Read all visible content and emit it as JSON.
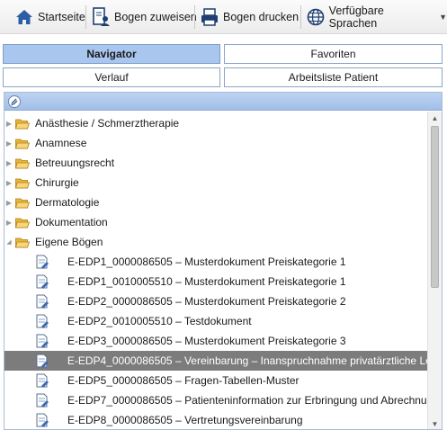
{
  "toolbar": {
    "home": "Startseite",
    "assign": "Bogen zuweisen",
    "print": "Bogen drucken",
    "languages": "Verfügbare Sprachen",
    "icons": {
      "home": "home-icon",
      "assign": "assign-form-icon",
      "print": "printer-icon",
      "languages": "globe-icon"
    }
  },
  "tabs": {
    "navigator": "Navigator",
    "favorites": "Favoriten",
    "history": "Verlauf",
    "worklist": "Arbeitsliste Patient"
  },
  "tree": {
    "folders": [
      "Anästhesie / Schmerztherapie",
      "Anamnese",
      "Betreuungsrecht",
      "Chirurgie",
      "Dermatologie",
      "Dokumentation",
      "Eigene Bögen"
    ],
    "documents": [
      "E-EDP1_0000086505 – Musterdokument Preiskategorie 1",
      "E-EDP1_0010005510 – Musterdokument Preiskategorie 1",
      "E-EDP2_0000086505 – Musterdokument Preiskategorie 2",
      "E-EDP2_0010005510 – Testdokument",
      "E-EDP3_0000086505 – Musterdokument Preiskategorie 3",
      "E-EDP4_0000086505 – Vereinbarung – Inanspruchnahme privatärztliche Le",
      "E-EDP5_0000086505 – Fragen-Tabellen-Muster",
      "E-EDP7_0000086505 – Patienteninformation zur Erbringung und Abrechnu",
      "E-EDP8_0000086505 – Vertretungsvereinbarung"
    ],
    "selected_document": "E-EDP4_0000086505 – Vereinbarung – Inanspruchnahme privatärztliche Le"
  },
  "colors": {
    "accent": "#a9c6ef",
    "selection": "#7c7c7c",
    "folder": "#f2c94c"
  }
}
